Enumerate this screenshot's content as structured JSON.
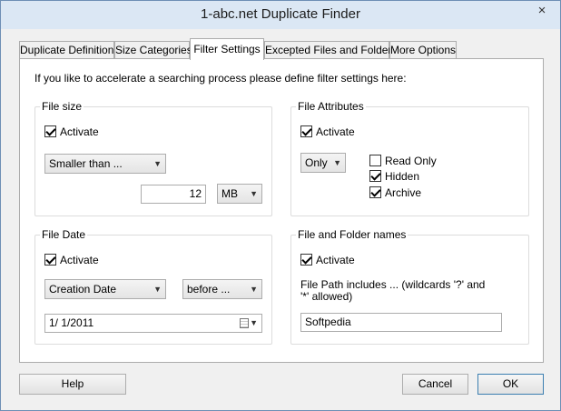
{
  "window": {
    "title": "1-abc.net Duplicate Finder",
    "close_icon": "×"
  },
  "tabs": [
    {
      "label": "Duplicate Definition"
    },
    {
      "label": "Size Categories"
    },
    {
      "label": "Filter Settings"
    },
    {
      "label": "Excepted Files and Folders"
    },
    {
      "label": "More Options"
    }
  ],
  "intro": "If you like to accelerate a searching process please define filter settings here:",
  "file_size": {
    "title": "File size",
    "activate_label": "Activate",
    "comparison": "Smaller than ...",
    "value": "12",
    "unit": "MB"
  },
  "file_attributes": {
    "title": "File Attributes",
    "activate_label": "Activate",
    "mode": "Only",
    "read_only_label": "Read Only",
    "hidden_label": "Hidden",
    "archive_label": "Archive"
  },
  "file_date": {
    "title": "File Date",
    "activate_label": "Activate",
    "date_type": "Creation Date",
    "comparison": "before ...",
    "date_value": "1/  1/2011"
  },
  "file_names": {
    "title": "File and Folder names",
    "activate_label": "Activate",
    "path_label": "File Path includes ... (wildcards '?' and '*' allowed)",
    "path_value": "Softpedia"
  },
  "buttons": {
    "help": "Help",
    "cancel": "Cancel",
    "ok": "OK"
  }
}
